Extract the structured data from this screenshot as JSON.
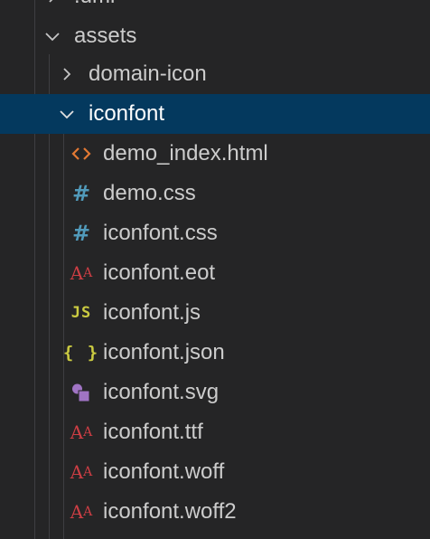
{
  "explorer": {
    "items": [
      {
        "label": ".umi",
        "type": "folder",
        "expanded": false,
        "depth": 1,
        "icon": "chevron-right-icon"
      },
      {
        "label": "assets",
        "type": "folder",
        "expanded": true,
        "depth": 1,
        "icon": "chevron-down-icon"
      },
      {
        "label": "domain-icon",
        "type": "folder",
        "expanded": false,
        "depth": 2,
        "icon": "chevron-right-icon"
      },
      {
        "label": "iconfont",
        "type": "folder",
        "expanded": true,
        "depth": 2,
        "selected": true,
        "icon": "chevron-down-icon"
      },
      {
        "label": "demo_index.html",
        "type": "file",
        "depth": 3,
        "icon": "html-file-icon"
      },
      {
        "label": "demo.css",
        "type": "file",
        "depth": 3,
        "icon": "css-file-icon"
      },
      {
        "label": "iconfont.css",
        "type": "file",
        "depth": 3,
        "icon": "css-file-icon"
      },
      {
        "label": "iconfont.eot",
        "type": "file",
        "depth": 3,
        "icon": "font-file-icon"
      },
      {
        "label": "iconfont.js",
        "type": "file",
        "depth": 3,
        "icon": "js-file-icon"
      },
      {
        "label": "iconfont.json",
        "type": "file",
        "depth": 3,
        "icon": "json-file-icon"
      },
      {
        "label": "iconfont.svg",
        "type": "file",
        "depth": 3,
        "icon": "svg-file-icon"
      },
      {
        "label": "iconfont.ttf",
        "type": "file",
        "depth": 3,
        "icon": "font-file-icon"
      },
      {
        "label": "iconfont.woff",
        "type": "file",
        "depth": 3,
        "icon": "font-file-icon"
      },
      {
        "label": "iconfont.woff2",
        "type": "file",
        "depth": 3,
        "icon": "font-file-icon"
      }
    ]
  },
  "icon_glyphs": {
    "css": "#",
    "js": "JS",
    "json": "{ }",
    "font_big": "A",
    "font_small": "A"
  },
  "colors": {
    "background": "#252526",
    "selection": "#04395e",
    "text": "#cccccc",
    "html_icon": "#e37933",
    "css_icon": "#519aba",
    "js_icon": "#cbcb41",
    "json_icon": "#cbcb41",
    "svg_icon": "#a074c4",
    "font_icon": "#cc3e44"
  }
}
